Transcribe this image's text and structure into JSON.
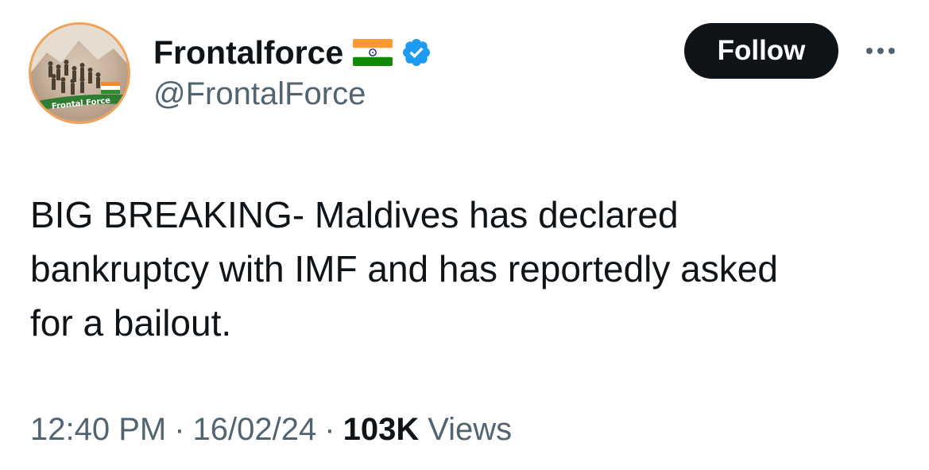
{
  "user": {
    "display_name": "Frontalforce",
    "handle": "@FrontalForce",
    "avatar_caption": "Frontal Force",
    "flag_icon": "india-flag-icon",
    "verified_icon": "verified-badge-icon",
    "verified_color": "#1d9bf0"
  },
  "actions": {
    "follow_label": "Follow",
    "more_icon": "more-options-icon"
  },
  "tweet": {
    "text": "BIG BREAKING- Maldives has declared\nbankruptcy with IMF and has reportedly asked\nfor a bailout."
  },
  "meta": {
    "time": "12:40 PM",
    "separator": "·",
    "date": "16/02/24",
    "views_count": "103K",
    "views_label": "Views"
  },
  "colors": {
    "text_primary": "#0f1419",
    "text_secondary": "#536471",
    "follow_bg": "#0f1419",
    "avatar_ring": "#f0a35a"
  }
}
